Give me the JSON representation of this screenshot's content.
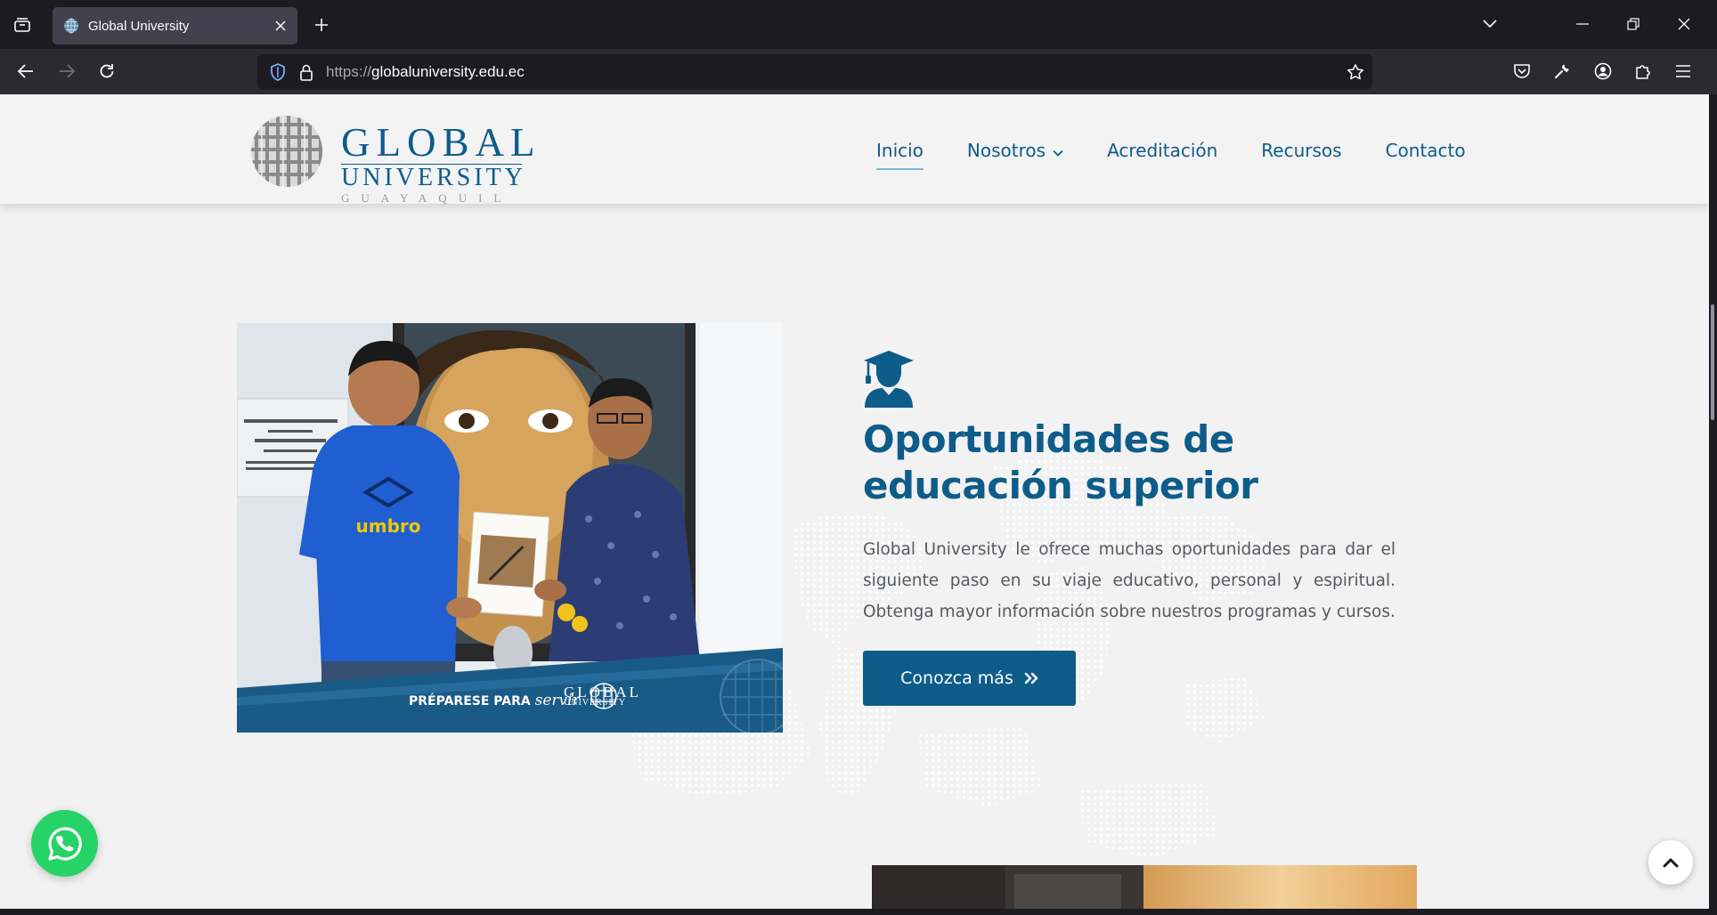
{
  "browser": {
    "tab_title": "Global University",
    "url_protocol": "https://",
    "url_host": "globaluniversity.edu.ec",
    "colors": {
      "chrome_dark": "#1c1b22",
      "toolbar": "#2b2a33",
      "active_tab": "#42414d"
    }
  },
  "icons": {
    "tab_list": "tab-list-icon",
    "close_tab": "close-icon",
    "new_tab": "plus-icon",
    "list_all_tabs": "chevron-down-icon",
    "minimize": "minimize-icon",
    "restore": "restore-icon",
    "close_window": "close-icon",
    "back": "back-arrow-icon",
    "forward": "forward-arrow-icon",
    "reload": "reload-icon",
    "tracking": "shield-icon",
    "lock": "lock-icon",
    "bookmark": "star-icon",
    "pocket": "pocket-icon",
    "tools": "wrench-icon",
    "account": "account-icon",
    "extensions": "puzzle-icon",
    "menu": "hamburger-icon",
    "graduate": "graduate-icon",
    "cta": "double-chevron-right-icon",
    "whatsapp": "whatsapp-icon",
    "scroll_top": "chevron-up-icon"
  },
  "site": {
    "logo": {
      "word1": "GLOBAL",
      "word2": "UNIVERSITY",
      "city": "GUAYAQUIL"
    },
    "menu": [
      {
        "label": "Inicio",
        "active": true
      },
      {
        "label": "Nosotros",
        "has_dropdown": true
      },
      {
        "label": "Acreditación"
      },
      {
        "label": "Recursos"
      },
      {
        "label": "Contacto"
      }
    ],
    "colors": {
      "brand": "#0e5c8a",
      "text": "#555a60",
      "background": "#f2f2f2",
      "whatsapp": "#25d366"
    }
  },
  "hero": {
    "photo_caption_1": "PRÉPARESE PARA",
    "photo_caption_2": "servir",
    "photo_logo_1": "GLOBAL",
    "photo_logo_2": "UNIVERSITY",
    "title": "Oportunidades de educación superior",
    "description": "Global University le ofrece muchas oportunidades para dar el siguiente paso en su viaje educativo, personal y espiritual. Obtenga mayor información sobre nuestros programas y cursos.",
    "cta_label": "Conozca más"
  }
}
